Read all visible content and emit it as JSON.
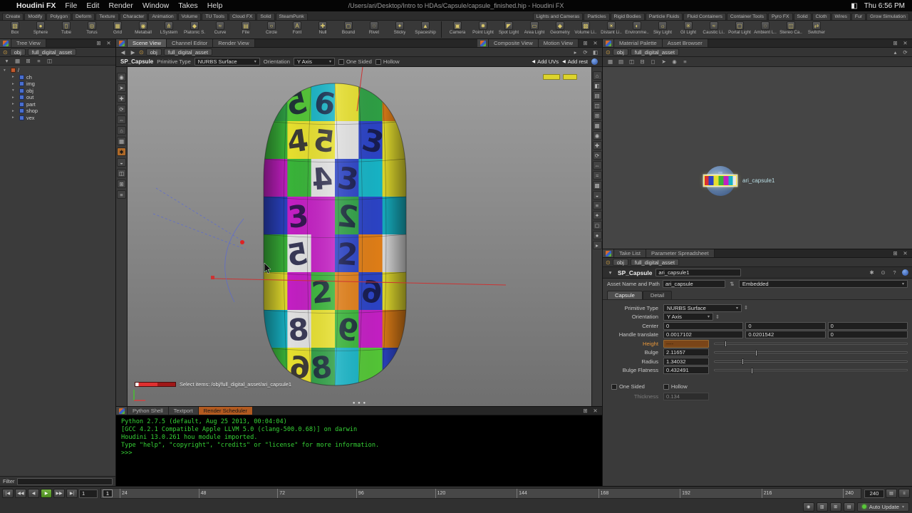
{
  "menubar": {
    "apple": "",
    "app_name": "Houdini FX",
    "menus": [
      "File",
      "Edit",
      "Render",
      "Window",
      "Takes",
      "Help"
    ],
    "window_title": "/Users/ari/Desktop/Intro to HDAs/Capsule/capsule_finished.hip - Houdini FX",
    "clock": "Thu 6:56 PM"
  },
  "shelf": {
    "left_tabs": [
      "Create",
      "Modify",
      "Polygon",
      "Deform",
      "Texture",
      "Character",
      "Animation",
      "Volume",
      "TU Tools",
      "Cloud FX",
      "Solid",
      "SteamPunk"
    ],
    "right_tabs": [
      "Lights and Cameras",
      "Particles",
      "Rigid Bodies",
      "Particle Fluids",
      "Fluid Containers",
      "Container Tools",
      "Pyro FX",
      "Solid",
      "Cloth",
      "Wires",
      "Fur",
      "Grow Simulation"
    ],
    "left_tools": [
      {
        "glyph": "▧",
        "label": "Box"
      },
      {
        "glyph": "●",
        "label": "Sphere"
      },
      {
        "glyph": "▯",
        "label": "Tube"
      },
      {
        "glyph": "◎",
        "label": "Torus"
      },
      {
        "glyph": "▦",
        "label": "Grid"
      },
      {
        "glyph": "◉",
        "label": "Metaball"
      },
      {
        "glyph": "⋔",
        "label": "LSystem"
      },
      {
        "glyph": "◆",
        "label": "Platonic S."
      },
      {
        "glyph": "≈",
        "label": "Curve"
      },
      {
        "glyph": "▤",
        "label": "File"
      },
      {
        "glyph": "○",
        "label": "Circle"
      },
      {
        "glyph": "A",
        "label": "Font"
      },
      {
        "glyph": "✚",
        "label": "Null"
      },
      {
        "glyph": "◻",
        "label": "Bound"
      },
      {
        "glyph": "◌",
        "label": "Rivet"
      },
      {
        "glyph": "✦",
        "label": "Sticky"
      },
      {
        "glyph": "▲",
        "label": "Spaceship"
      }
    ],
    "right_tools": [
      {
        "glyph": "▣",
        "label": "Camera"
      },
      {
        "glyph": "✹",
        "label": "Point Light"
      },
      {
        "glyph": "◤",
        "label": "Spot Light"
      },
      {
        "glyph": "▭",
        "label": "Area Light"
      },
      {
        "glyph": "◆",
        "label": "Geometry"
      },
      {
        "glyph": "▩",
        "label": "Volume Li.."
      },
      {
        "glyph": "☀",
        "label": "Distant Li.."
      },
      {
        "glyph": "◐",
        "label": "Environme.."
      },
      {
        "glyph": "☼",
        "label": "Sky Light"
      },
      {
        "glyph": "✳",
        "label": "GI Light"
      },
      {
        "glyph": "≈",
        "label": "Caustic Li.."
      },
      {
        "glyph": "▢",
        "label": "Portal Light"
      },
      {
        "glyph": "◌",
        "label": "Ambient L.."
      },
      {
        "glyph": "◫",
        "label": "Stereo Ca.."
      },
      {
        "glyph": "⇄",
        "label": "Switcher"
      }
    ]
  },
  "tree_panel": {
    "tab_label": "Tree View",
    "path": {
      "root": "obj",
      "current": "full_digital_asset"
    },
    "items": [
      {
        "arrow": "▾",
        "label": "/"
      },
      {
        "arrow": "▸",
        "label": "ch"
      },
      {
        "arrow": "▸",
        "label": "img"
      },
      {
        "arrow": "▾",
        "label": "obj"
      },
      {
        "arrow": "▸",
        "label": "out"
      },
      {
        "arrow": "▸",
        "label": "part"
      },
      {
        "arrow": "▸",
        "label": "shop"
      },
      {
        "arrow": "▸",
        "label": "vex"
      }
    ],
    "filter_label": "Filter"
  },
  "viewport": {
    "tabs_left": [
      "Scene View",
      "Channel Editor",
      "Render View"
    ],
    "tabs_right": [
      "Composite View",
      "Motion View"
    ],
    "path": {
      "root": "obj",
      "current": "full_digital_asset"
    },
    "toolbar": {
      "node_label": "SP_Capsule",
      "primitive_type_label": "Primitive Type",
      "primitive_type_value": "NURBS Surface",
      "orientation_label": "Orientation",
      "orientation_value": "Y Axis",
      "one_sided_label": "One Sided",
      "hollow_label": "Hollow",
      "add_uvs_label": "Add UVs",
      "add_rest_label": "Add rest"
    },
    "left_tools": [
      "◉",
      "➤",
      "✚",
      "⟳",
      "⇔",
      "⌂",
      "▦",
      "✱",
      "◒",
      "◫",
      "⊞",
      "≡"
    ],
    "right_tools": [
      "⌂",
      "◧",
      "▤",
      "◫",
      "⊞",
      "▦",
      "◉",
      "✚",
      "⟳",
      "⇔",
      "≈",
      "▩",
      "◒",
      "≡",
      "✦",
      "◻",
      "●",
      "▸"
    ],
    "status": {
      "select_prompt": "Select items:  /obj/full_digital_asset/ari_capsule1"
    }
  },
  "network_panel": {
    "tabs": [
      "Material Palette",
      "Asset Browser"
    ],
    "path": {
      "root": "obj",
      "current": "full_digital_asset"
    },
    "toolbar_icons": [
      "▦",
      "▤",
      "◫",
      "⊟",
      "◻",
      "➤",
      "◉",
      "≡"
    ],
    "node_name": "ari_capsule1"
  },
  "params_panel": {
    "tabs": [
      "Take List",
      "Parameter Spreadsheet"
    ],
    "path": {
      "root": "obj",
      "current": "full_digital_asset"
    },
    "header": {
      "type_name": "SP_Capsule",
      "node_name": "ari_capsule1"
    },
    "asset": {
      "label": "Asset Name and Path",
      "value": "ari_capsule",
      "mode": "Embedded"
    },
    "folder_tabs": [
      "Capsule",
      "Detail"
    ],
    "primitive_type": {
      "label": "Primitive Type",
      "value": "NURBS Surface"
    },
    "orientation": {
      "label": "Orientation",
      "value": "Y Axis"
    },
    "center": {
      "label": "Center",
      "x": "0",
      "y": "0",
      "z": "0"
    },
    "handle_translate": {
      "label": "Handle translate",
      "x": "0.0017102",
      "y": "0.0201542",
      "z": "0"
    },
    "height": {
      "label": "Height",
      "value": "----"
    },
    "bulge": {
      "label": "Bulge",
      "value": "2.11657"
    },
    "radius": {
      "label": "Radius",
      "value": "1.34032"
    },
    "bulge_flatness": {
      "label": "Bulge Flatness",
      "value": "0.432491"
    },
    "one_sided_label": "One Sided",
    "hollow_label": "Hollow",
    "thickness": {
      "label": "Thickness",
      "value": "0.134"
    }
  },
  "console": {
    "tabs": [
      "Python Shell",
      "Textport",
      "Render Scheduler"
    ],
    "lines": [
      "Python 2.7.5 (default, Aug 25 2013, 00:04:04)",
      "[GCC 4.2.1 Compatible Apple LLVM 5.0 (clang-500.0.68)] on darwin",
      "Houdini 13.0.261 hou module imported.",
      "Type \"help\", \"copyright\", \"credits\" or \"license\" for more information.",
      ">>>"
    ]
  },
  "timeline": {
    "transport": [
      {
        "glyph": "|◀"
      },
      {
        "glyph": "◀◀"
      },
      {
        "glyph": "◀"
      },
      {
        "glyph": "▶"
      },
      {
        "glyph": "▶▶"
      },
      {
        "glyph": "▶|"
      }
    ],
    "frame_field": "1",
    "current_frame": "1",
    "ticks": [
      "24",
      "48",
      "72",
      "96",
      "120",
      "144",
      "168",
      "192",
      "216",
      "240"
    ],
    "end_frame": "240",
    "auto_update_label": "Auto Update"
  },
  "capsule": {
    "rows": [
      [
        "#2e9e44",
        "#53c436",
        "#17b2c4",
        "#e6df2e",
        "#2e9e44",
        "#de7d17"
      ],
      [
        "#39b339",
        "#e6df2e",
        "#e6df2e",
        "#e0e0e0",
        "#2b43c4",
        "#e6df2e"
      ],
      [
        "#c21fc2",
        "#39b339",
        "#e0e0e0",
        "#2b43c4",
        "#17b2c4",
        "#e6df2e"
      ],
      [
        "#2b43c4",
        "#c21fc2",
        "#c21fc2",
        "#2e9e44",
        "#2b43c4",
        "#17b2c4"
      ],
      [
        "#39b339",
        "#e0e0e0",
        "#c21fc2",
        "#2b43c4",
        "#de7d17",
        "#e0e0e0"
      ],
      [
        "#e6df2e",
        "#c21fc2",
        "#39b339",
        "#de7d17",
        "#2b43c4",
        "#e6df2e"
      ],
      [
        "#17b2c4",
        "#e0e0e0",
        "#e6df2e",
        "#39b339",
        "#c21fc2",
        "#de7d17"
      ],
      [
        "#39b339",
        "#e6df2e",
        "#2e9e44",
        "#17b2c4",
        "#53c436",
        "#2b43c4"
      ]
    ],
    "numbers": [
      {
        "r": 0,
        "c": 1,
        "t": "5",
        "rot": -14,
        "flip": true
      },
      {
        "r": 0,
        "c": 2,
        "t": "6",
        "rot": 10,
        "flip": false
      },
      {
        "r": 1,
        "c": 1,
        "t": "4",
        "rot": -8,
        "flip": false
      },
      {
        "r": 1,
        "c": 2,
        "t": "5",
        "rot": 6,
        "flip": true
      },
      {
        "r": 1,
        "c": 4,
        "t": "3",
        "rot": 14,
        "flip": false
      },
      {
        "r": 2,
        "c": 2,
        "t": "4",
        "rot": -4,
        "flip": true
      },
      {
        "r": 2,
        "c": 3,
        "t": "3",
        "rot": 8,
        "flip": false
      },
      {
        "r": 3,
        "c": 1,
        "t": "3",
        "rot": -6,
        "flip": false
      },
      {
        "r": 3,
        "c": 3,
        "t": "2",
        "rot": 6,
        "flip": true
      },
      {
        "r": 4,
        "c": 1,
        "t": "5",
        "rot": -10,
        "flip": true
      },
      {
        "r": 4,
        "c": 3,
        "t": "2",
        "rot": 4,
        "flip": false
      },
      {
        "r": 5,
        "c": 2,
        "t": "2",
        "rot": -6,
        "flip": false
      },
      {
        "r": 5,
        "c": 4,
        "t": "6",
        "rot": 8,
        "flip": true
      },
      {
        "r": 6,
        "c": 1,
        "t": "8",
        "rot": -4,
        "flip": false
      },
      {
        "r": 6,
        "c": 3,
        "t": "9",
        "rot": 6,
        "flip": true
      },
      {
        "r": 7,
        "c": 1,
        "t": "6",
        "rot": 4,
        "flip": true
      },
      {
        "r": 7,
        "c": 2,
        "t": "8",
        "rot": -8,
        "flip": false
      }
    ]
  }
}
